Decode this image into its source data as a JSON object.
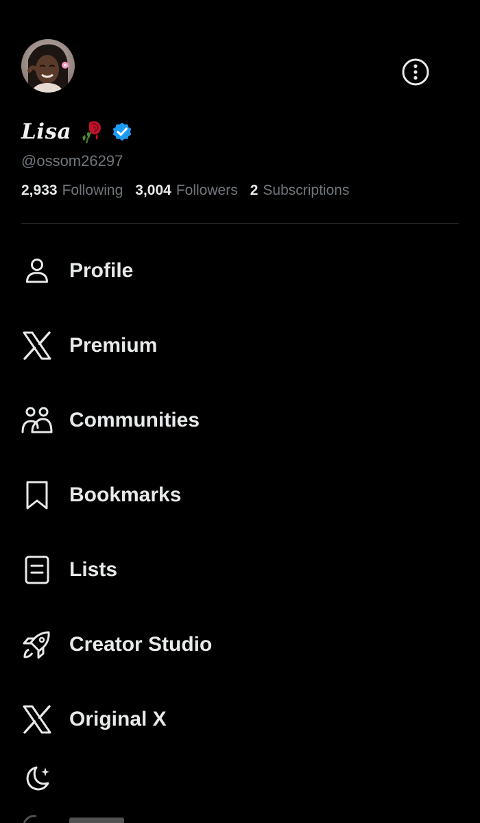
{
  "profile": {
    "display_name": "Lisa",
    "handle": "@ossom26297",
    "name_emoji": "rose-wilted-icon",
    "verified": true,
    "colors": {
      "verified_badge": "#1d9bf0",
      "background": "#000000",
      "primary_text": "#e7e9ea",
      "secondary_text": "#71767b",
      "divider": "#2f3336"
    }
  },
  "stats": [
    {
      "count": "2,933",
      "label": "Following"
    },
    {
      "count": "3,004",
      "label": "Followers"
    },
    {
      "count": "2",
      "label": "Subscriptions"
    }
  ],
  "menu": [
    {
      "label": "Profile",
      "icon": "person-icon"
    },
    {
      "label": "Premium",
      "icon": "x-logo-icon"
    },
    {
      "label": "Communities",
      "icon": "communities-icon"
    },
    {
      "label": "Bookmarks",
      "icon": "bookmark-icon"
    },
    {
      "label": "Lists",
      "icon": "list-icon"
    },
    {
      "label": "Creator Studio",
      "icon": "rocket-icon"
    },
    {
      "label": "Original X",
      "icon": "x-logo-icon"
    }
  ],
  "footer": {
    "theme_toggle_icon": "moon-stars-icon"
  },
  "header": {
    "more_icon": "more-options-icon"
  }
}
